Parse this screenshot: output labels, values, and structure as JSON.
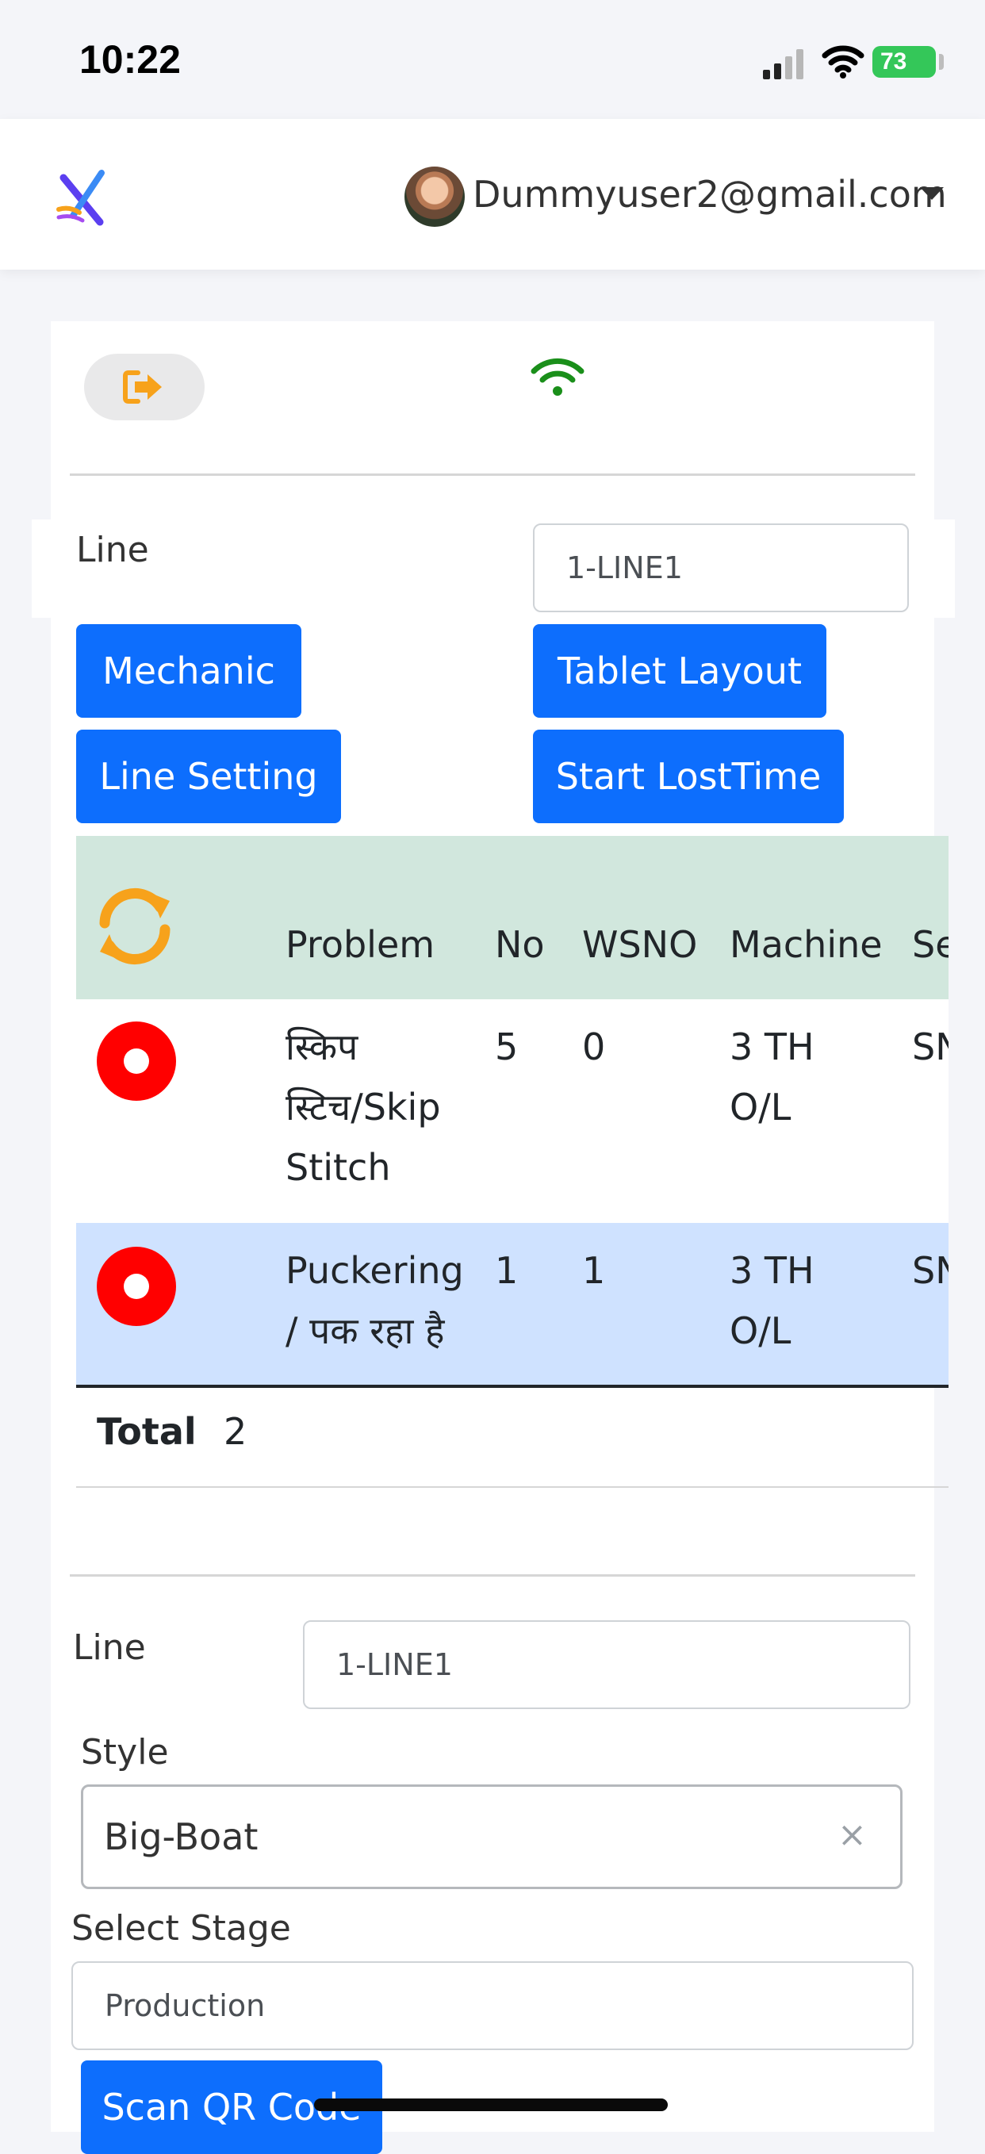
{
  "status_bar": {
    "time": "10:22",
    "battery": "73"
  },
  "header": {
    "user_email": "Dummyuser2@gmail.com"
  },
  "toolbar": {
    "line_label": "Line",
    "line_value": "1-LINE1"
  },
  "buttons": {
    "mechanic": "Mechanic",
    "tablet_layout": "Tablet Layout",
    "line_setting": "Line Setting",
    "start_losttime": "Start LostTime"
  },
  "table": {
    "headers": [
      "Problem",
      "No",
      "WSNO",
      "Machine",
      "Se"
    ],
    "rows": [
      {
        "problem_lines": [
          "स्किप",
          "स्टिच/Skip",
          "Stitch"
        ],
        "no": "5",
        "wsno": "0",
        "machine_lines": [
          "3 TH",
          "O/L"
        ],
        "extra": "SN"
      },
      {
        "problem_lines": [
          "Puckering",
          "/ पक रहा है"
        ],
        "no": "1",
        "wsno": "1",
        "machine_lines": [
          "3 TH",
          "O/L"
        ],
        "extra": "SN"
      }
    ],
    "total_label": "Total",
    "total_value": "2"
  },
  "form": {
    "line_label": "Line",
    "line_value": "1-LINE1",
    "style_label": "Style",
    "style_value": "Big-Boat",
    "style_clear": "×",
    "stage_label": "Select Stage",
    "stage_value": "Production",
    "scan_button": "Scan QR Code"
  },
  "colors": {
    "primary": "#0d6efd",
    "accent_orange": "#f7a21b",
    "alert_red": "#ff0000",
    "wifi_green": "#1a8f1a",
    "header_row": "#d1e7dd",
    "highlight_row": "#cfe2ff"
  },
  "icons": [
    "logout-icon",
    "wifi-connected-icon",
    "refresh-icon",
    "alert-dot-icon",
    "chevron-down-icon"
  ]
}
